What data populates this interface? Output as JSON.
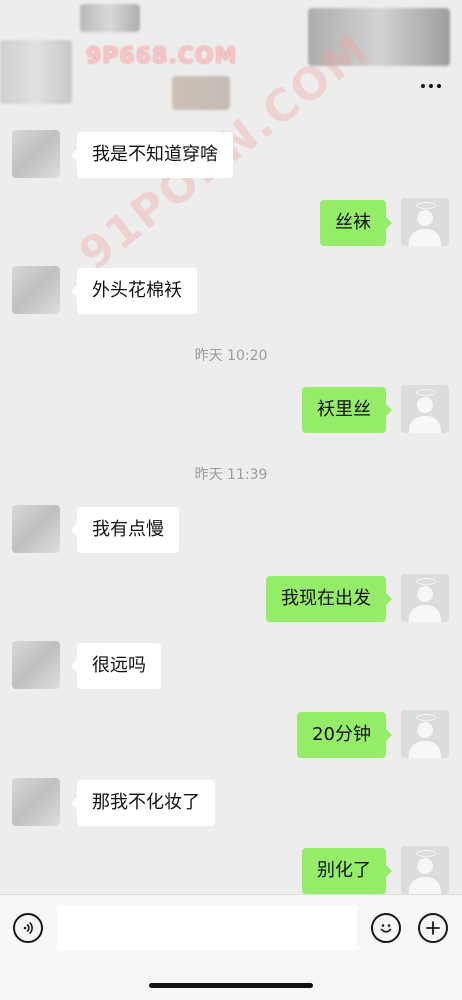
{
  "header": {
    "title": "",
    "more_label": "more"
  },
  "watermarks": {
    "top": "9P668.COM",
    "diagonal": "91PORN.COM"
  },
  "messages": [
    {
      "side": "left",
      "text": "我是不知道穿啥"
    },
    {
      "side": "right",
      "text": "丝袜"
    },
    {
      "side": "left",
      "text": "外头花棉袄"
    },
    {
      "time": "昨天 10:20"
    },
    {
      "side": "right",
      "text": "袄里丝"
    },
    {
      "time": "昨天 11:39"
    },
    {
      "side": "left",
      "text": "我有点慢"
    },
    {
      "side": "right",
      "text": "我现在出发"
    },
    {
      "side": "left",
      "text": "很远吗"
    },
    {
      "side": "right",
      "text": "20分钟"
    },
    {
      "side": "left",
      "text": "那我不化妆了"
    },
    {
      "side": "right",
      "text": "别化了"
    }
  ],
  "input": {
    "placeholder": "",
    "value": ""
  },
  "colors": {
    "background": "#ededed",
    "outgoing_bubble": "#95ec69",
    "incoming_bubble": "#ffffff",
    "timestamp": "#9b9b9b"
  },
  "icons": {
    "voice": "voice-icon",
    "emoji": "emoji-icon",
    "plus": "plus-icon",
    "more": "more-icon"
  }
}
